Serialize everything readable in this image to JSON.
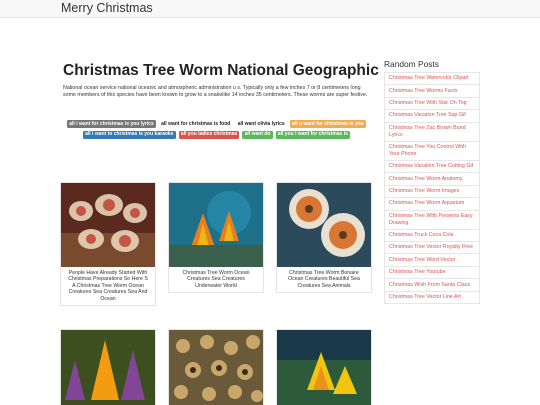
{
  "header": {
    "brand": "Merry Christmas"
  },
  "article": {
    "title": "Christmas Tree Worm National Geographic",
    "description": "National ocean service national oceanic and atmospheric administration u s. Typically only a few inches 7 or 8 centimeters long some members of this species have been known to grow to a snakelike 14 inches 35 centimeters. These worms are super festive."
  },
  "tags": [
    {
      "label": "all i want for christmas is you lyrics",
      "bg": "#777777",
      "fg": "#ffffff"
    },
    {
      "label": "all want for christmas is food",
      "bg": "transparent",
      "fg": "#222222"
    },
    {
      "label": "all want olivia lyrics",
      "bg": "transparent",
      "fg": "#222222"
    },
    {
      "label": "all u want for christmas is you",
      "bg": "#f0ad4e",
      "fg": "#ffffff"
    },
    {
      "label": "all i want to christmas is you karaoke",
      "bg": "#337ab7",
      "fg": "#ffffff"
    },
    {
      "label": "all you ladies christmas",
      "bg": "#d9534f",
      "fg": "#ffffff"
    },
    {
      "label": "all want do",
      "bg": "#5cb85c",
      "fg": "#ffffff"
    },
    {
      "label": "all you i want for christmas is",
      "bg": "#5cb85c",
      "fg": "#ffffff"
    }
  ],
  "cards": [
    {
      "caption": "People Have Already Started With Christmas Preparations So Here S A Christmas Tree Worm Ocean Creatures Sea Creatures Sea And Ocean"
    },
    {
      "caption": "Christmas Tree Worm Ocean Creatures Sea Creatures Underwater World"
    },
    {
      "caption": "Christmas Tree Worm Bonaire Ocean Creatures Beautiful Sea Creatures Sea Animals"
    },
    {
      "caption": ""
    },
    {
      "caption": ""
    },
    {
      "caption": ""
    }
  ],
  "sidebar": {
    "title": "Random Posts",
    "items": [
      "Christmas Tree Watercolor Clipart",
      "Christmas Tree Worms Facts",
      "Christmas Tree With Star On Top",
      "Christmas Vacation Tree Sap Gif",
      "Christmas Tree Zac Brown Band Lyrics",
      "Christmas Tree You Control With Your Phone",
      "Christmas Vacation Tree Cutting Gif",
      "Christmas Tree Worm Anatomy",
      "Christmas Tree Worm Images",
      "Christmas Tree Worm Aquarium",
      "Christmas Tree With Presents Easy Drawing",
      "Christmas Truck Coca Cola",
      "Christmas Tree Vector Royalty Free",
      "Christmas Tree Word Vector",
      "Christmas Tree Youtube",
      "Christmas Wish From Santa Claus",
      "Christmas Tree Vector Line Art"
    ]
  },
  "colors": {
    "link": "#d9534f",
    "navbar": "#f8f8f8"
  }
}
